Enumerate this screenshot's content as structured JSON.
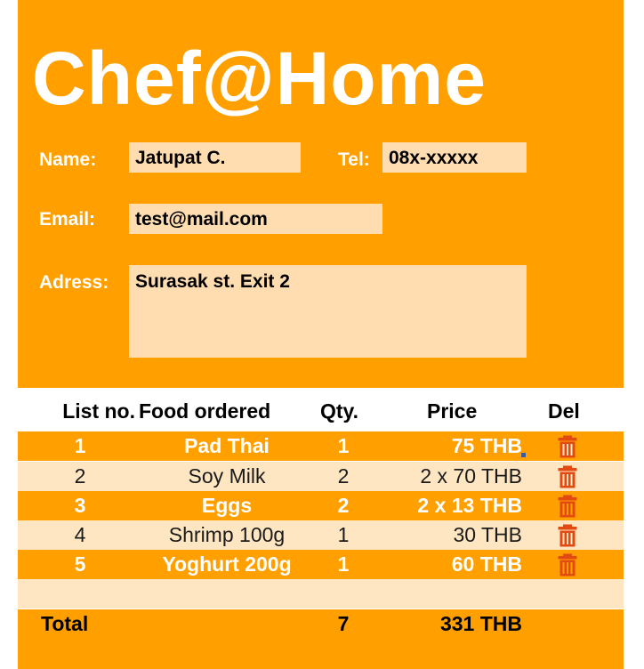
{
  "brand": {
    "title": "Chef@Home"
  },
  "customer": {
    "name_label": "Name:",
    "name_value": "Jatupat C.",
    "tel_label": "Tel:",
    "tel_value": "08x-xxxxx",
    "email_label": "Email:",
    "email_value": "test@mail.com",
    "address_label": "Adress:",
    "address_value": "Surasak st. Exit 2"
  },
  "order_table": {
    "headers": {
      "no": "List no.",
      "food": "Food ordered",
      "qty": "Qty.",
      "price": "Price",
      "del": "Del"
    },
    "rows": [
      {
        "no": "1",
        "food": "Pad Thai",
        "qty": "1",
        "price": "75 THB"
      },
      {
        "no": "2",
        "food": "Soy Milk",
        "qty": "2",
        "price": "2 x 70 THB"
      },
      {
        "no": "3",
        "food": "Eggs",
        "qty": "2",
        "price": "2 x 13 THB"
      },
      {
        "no": "4",
        "food": "Shrimp 100g",
        "qty": "1",
        "price": "30 THB"
      },
      {
        "no": "5",
        "food": "Yoghurt 200g",
        "qty": "1",
        "price": "60 THB"
      }
    ],
    "delete_icon": "trash-icon",
    "total": {
      "label": "Total",
      "qty": "7",
      "price": "331 THB"
    }
  },
  "colors": {
    "accent": "#FFA000",
    "field_bg": "#FFDDB0",
    "row_alt": "#FFE6C2",
    "delete_icon": "#E34A12"
  }
}
